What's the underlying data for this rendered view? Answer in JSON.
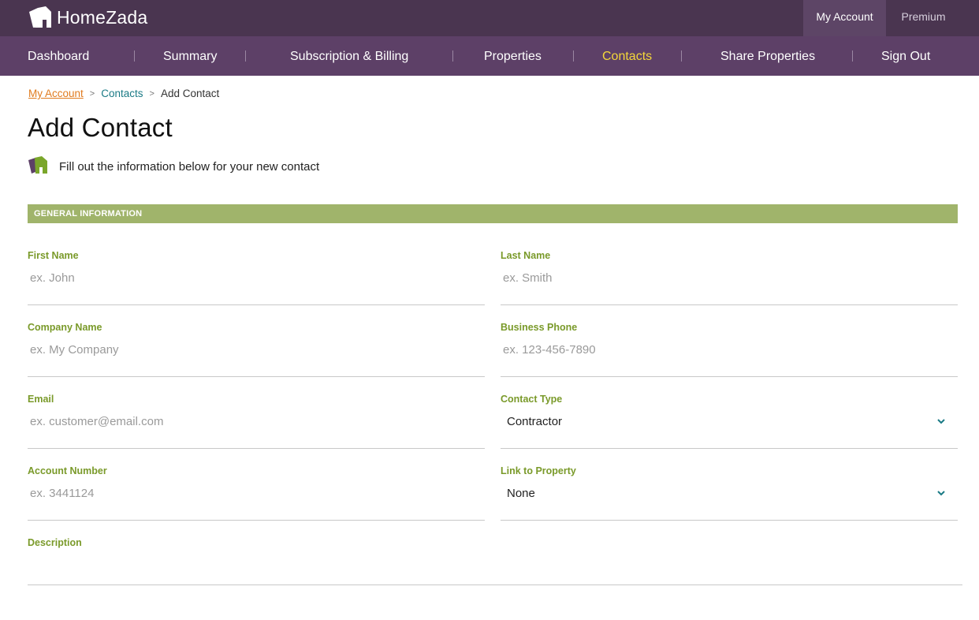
{
  "app": {
    "logo_text": "HomeZada"
  },
  "topbar": {
    "my_account": "My Account",
    "premium": "Premium"
  },
  "nav": {
    "items": [
      {
        "label": "Dashboard"
      },
      {
        "label": "Summary"
      },
      {
        "label": "Subscription & Billing"
      },
      {
        "label": "Properties"
      },
      {
        "label": "Contacts"
      },
      {
        "label": "Share Properties"
      },
      {
        "label": "Sign Out"
      }
    ],
    "active": "Contacts"
  },
  "breadcrumb": {
    "items": [
      "My Account",
      "Contacts",
      "Add Contact"
    ],
    "separator": ">"
  },
  "page": {
    "title": "Add Contact",
    "intro": "Fill out the information below for your new contact"
  },
  "section": {
    "title": "GENERAL INFORMATION"
  },
  "form": {
    "first_name": {
      "label": "First Name",
      "placeholder": "ex. John"
    },
    "last_name": {
      "label": "Last Name",
      "placeholder": "ex. Smith"
    },
    "company_name": {
      "label": "Company Name",
      "placeholder": "ex. My Company"
    },
    "business_phone": {
      "label": "Business Phone",
      "placeholder": "ex. 123-456-7890"
    },
    "email": {
      "label": "Email",
      "placeholder": "ex. customer@email.com"
    },
    "contact_type": {
      "label": "Contact Type",
      "value": "Contractor"
    },
    "account_number": {
      "label": "Account Number",
      "placeholder": "ex. 3441124"
    },
    "link_to_property": {
      "label": "Link to Property",
      "value": "None"
    },
    "description": {
      "label": "Description"
    }
  },
  "colors": {
    "topbar_bg": "#4a3550",
    "nav_bg": "#5d4067",
    "nav_active": "#f4d73a",
    "section_bar": "#a0b46b",
    "label_green": "#7a9a2a",
    "breadcrumb_orange": "#e07b1f",
    "breadcrumb_teal": "#1a7a85"
  },
  "icons": {
    "logo": "house-logo-icon",
    "intro": "house-logo-icon",
    "select": "chevron-down-icon"
  }
}
